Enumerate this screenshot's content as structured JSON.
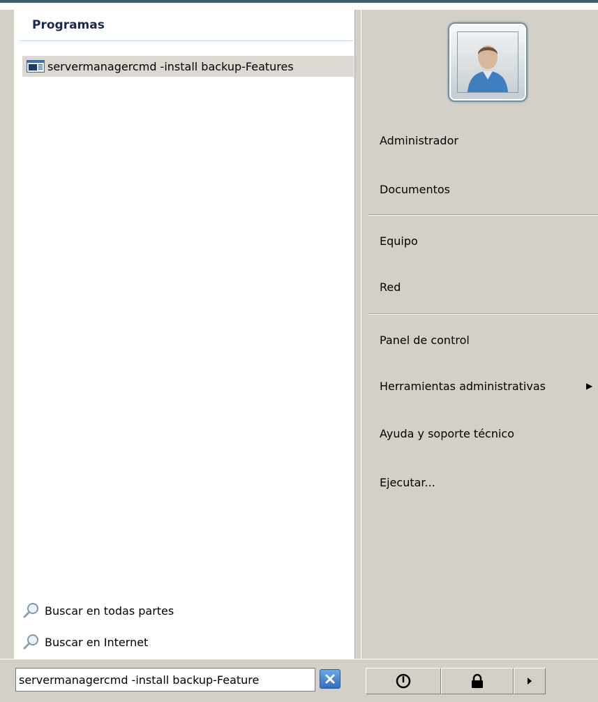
{
  "left_pane": {
    "section_header": "Programas",
    "programs": [
      {
        "label": "servermanagercmd -install backup-Features",
        "icon": "console-program-icon"
      }
    ],
    "search_links": [
      {
        "label": "Buscar en todas partes",
        "icon": "search-icon"
      },
      {
        "label": "Buscar en Internet",
        "icon": "search-icon"
      }
    ]
  },
  "right_pane": {
    "avatar": "user-avatar-icon",
    "items": [
      {
        "label": "Administrador"
      },
      {
        "label": "Documentos"
      },
      {
        "label": "Equipo"
      },
      {
        "label": "Red"
      },
      {
        "label": "Panel de control"
      },
      {
        "label": "Herramientas administrativas",
        "has_submenu": true
      },
      {
        "label": "Ayuda y soporte técnico"
      },
      {
        "label": "Ejecutar..."
      }
    ]
  },
  "bottom_bar": {
    "search_value": "servermanagercmd -install backup-Feature",
    "clear_icon": "close-icon",
    "power_icon": "power-icon",
    "lock_icon": "lock-icon",
    "arrow_icon": "chevron-right-icon"
  },
  "colors": {
    "accent_border": "#3b6170",
    "panel_bg": "#d4d0c8",
    "selection_bg": "#dcd9d3",
    "header_text": "#1c2a4a"
  }
}
